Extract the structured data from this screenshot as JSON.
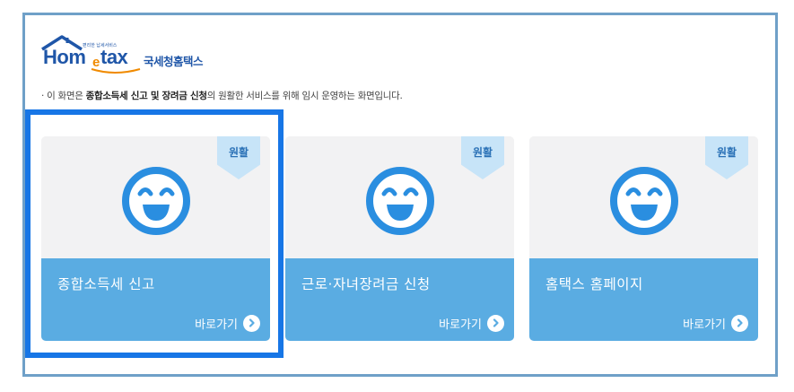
{
  "logo": {
    "tagline": "편리한 납세서비스",
    "brand_home": "Hom",
    "brand_e": "e",
    "brand_tax": "tax",
    "brand_korean": "국세청홈택스"
  },
  "notice": {
    "prefix": "· 이 화면은 ",
    "bold": "종합소득세 신고 및 장려금 신청",
    "suffix": "의 원활한 서비스를 위해 임시 운영하는 화면입니다."
  },
  "cards": [
    {
      "status": "원활",
      "title": "종합소득세 신고",
      "link": "바로가기",
      "icon": "smiley-face-icon"
    },
    {
      "status": "원활",
      "title": "근로·자녀장려금 신청",
      "link": "바로가기",
      "icon": "smiley-face-icon"
    },
    {
      "status": "원활",
      "title": "홈택스 홈페이지",
      "link": "바로가기",
      "icon": "smiley-face-icon"
    }
  ],
  "colors": {
    "frame_border": "#6fa0c8",
    "card_bottom": "#5aace2",
    "badge": "#c7e4f8",
    "face": "#2a8ee0",
    "highlight": "#1776e6",
    "logo_blue": "#1f56a8",
    "logo_orange": "#f08a00"
  },
  "selected_card": 0
}
